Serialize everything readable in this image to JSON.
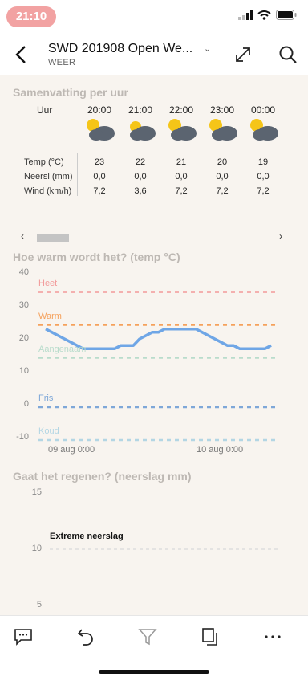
{
  "status": {
    "time": "21:10"
  },
  "header": {
    "title": "SWD 201908 Open We...",
    "subtitle": "WEER"
  },
  "summary": {
    "title": "Samenvatting per uur",
    "hour_label": "Uur",
    "hours": [
      "20:00",
      "21:00",
      "22:00",
      "23:00",
      "00:00"
    ],
    "rows": [
      {
        "label": "Temp (°C)",
        "values": [
          "23",
          "22",
          "21",
          "20",
          "19"
        ]
      },
      {
        "label": "Neersl (mm)",
        "values": [
          "0,0",
          "0,0",
          "0,0",
          "0,0",
          "0,0"
        ]
      },
      {
        "label": "Wind (km/h)",
        "values": [
          "7,2",
          "3,6",
          "7,2",
          "7,2",
          "7,2"
        ]
      }
    ],
    "icons": [
      "partly-cloudy-night-icon",
      "cloudy-icon",
      "partly-cloudy-night-icon",
      "partly-cloudy-night-icon",
      "partly-cloudy-night-icon"
    ]
  },
  "scroll": {
    "left": "‹",
    "right": "›"
  },
  "temp_chart_title": "Hoe warm wordt het? (temp °C)",
  "rain_chart_title": "Gaat het regenen? (neerslag mm)",
  "chart_data": [
    {
      "type": "line",
      "title": "Hoe warm wordt het? (temp °C)",
      "ylim": [
        -10,
        40
      ],
      "yticks": [
        "40",
        "30",
        "20",
        "10",
        "0",
        "-10"
      ],
      "x_tick_labels": [
        "09 aug 0:00",
        "10 aug 0:00"
      ],
      "reference_lines": [
        {
          "name": "Heet",
          "value": 35,
          "color": "#f29a9a"
        },
        {
          "name": "Warm",
          "value": 25,
          "color": "#f5a15c"
        },
        {
          "name": "Aangenaam",
          "value": 15,
          "color": "#b9dccc"
        },
        {
          "name": "Fris",
          "value": 0,
          "color": "#7ea7d8"
        },
        {
          "name": "Koud",
          "value": -10,
          "color": "#b3d6e4"
        }
      ],
      "series": [
        {
          "color": "#6fa6e6",
          "values": [
            23,
            22,
            21,
            20,
            19,
            18,
            17,
            17,
            17,
            17,
            17,
            17,
            18,
            18,
            18,
            20,
            21,
            22,
            22,
            23,
            23,
            23,
            23,
            23,
            23,
            22,
            21,
            20,
            19,
            18,
            18,
            17,
            17,
            17,
            17,
            17,
            18
          ]
        }
      ]
    },
    {
      "type": "line",
      "title": "Gaat het regenen? (neerslag mm)",
      "ylim": [
        0,
        15
      ],
      "yticks": [
        "15",
        "10",
        "5"
      ],
      "reference_lines": [
        {
          "name": "Extreme neerslag",
          "value": 10,
          "color": "#dddddd"
        }
      ]
    }
  ],
  "toolbar": [
    "comment-icon",
    "undo-icon",
    "filter-icon",
    "pages-icon",
    "more-icon"
  ]
}
